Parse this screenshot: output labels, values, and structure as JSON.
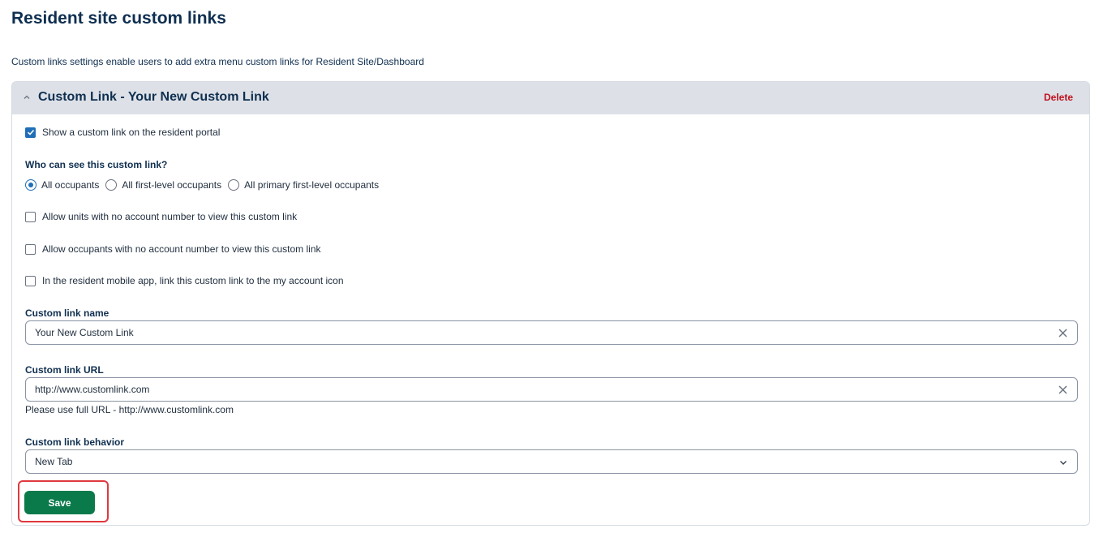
{
  "page": {
    "title": "Resident site custom links",
    "description": "Custom links settings enable users to add extra menu custom links for Resident Site/Dashboard"
  },
  "panel": {
    "title": "Custom Link - Your New Custom Link",
    "delete_label": "Delete",
    "show_link": {
      "label": "Show a custom link on the resident portal",
      "checked": true
    },
    "visibility": {
      "question": "Who can see this custom link?",
      "options": [
        "All occupants",
        "All first-level occupants",
        "All primary first-level occupants"
      ],
      "selected": "All occupants"
    },
    "allow_units": {
      "label": "Allow units with no account number to view this custom link",
      "checked": false
    },
    "allow_occupants": {
      "label": "Allow occupants with no account number to view this custom link",
      "checked": false
    },
    "mobile_link": {
      "label": "In the resident mobile app, link this custom link to the my account icon",
      "checked": false
    },
    "name_field": {
      "label": "Custom link name",
      "value": "Your New Custom Link"
    },
    "url_field": {
      "label": "Custom link URL",
      "value": "http://www.customlink.com",
      "hint": "Please use full URL - http://www.customlink.com"
    },
    "behavior_field": {
      "label": "Custom link behavior",
      "value": "New Tab"
    },
    "save_label": "Save"
  },
  "colors": {
    "accent": "#1f6fb8",
    "save": "#0b7a4b",
    "delete": "#c0111f",
    "highlight": "#e0393e"
  }
}
